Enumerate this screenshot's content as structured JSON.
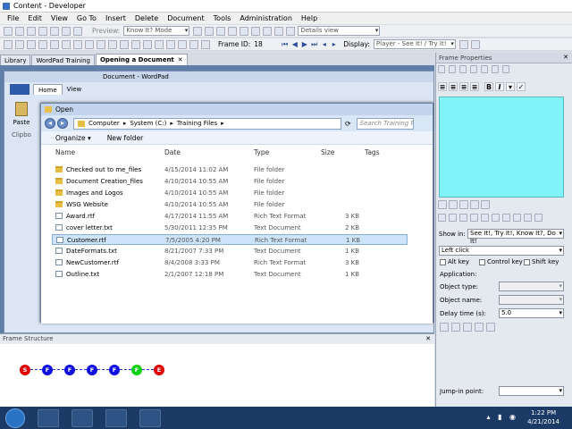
{
  "window": {
    "title": "Content - Developer"
  },
  "menu": [
    "File",
    "Edit",
    "View",
    "Go To",
    "Insert",
    "Delete",
    "Document",
    "Tools",
    "Administration",
    "Help"
  ],
  "toolbar": {
    "preview_label": "Preview:",
    "mode_value": "Know It? Mode",
    "view_value": "Details view",
    "frame_id_label": "Frame ID:",
    "frame_id": "18",
    "display_label": "Display:",
    "display_value": "Player - See It! / Try It!"
  },
  "tabs": [
    "Library",
    "WordPad Training",
    "Opening a Document"
  ],
  "wordpad": {
    "title": "Document - WordPad",
    "tab_home": "Home",
    "tab_view": "View",
    "paste": "Paste",
    "clipboard": "Clipbo"
  },
  "dialog": {
    "title": "Open",
    "path": [
      "Computer",
      "▸",
      "System (C:)",
      "▸",
      "Training Files",
      "▸"
    ],
    "search_placeholder": "Search Training Fi",
    "organize": "Organize ▾",
    "new_folder": "New folder",
    "columns": [
      "Name",
      "Date",
      "Type",
      "Size",
      "Tags"
    ],
    "files": [
      {
        "name": "Checked out to me_files",
        "date": "4/15/2014 11:02 AM",
        "type": "File folder",
        "size": "",
        "kind": "folder"
      },
      {
        "name": "Document Creation_files",
        "date": "4/10/2014 10:55 AM",
        "type": "File folder",
        "size": "",
        "kind": "folder"
      },
      {
        "name": "Images and Logos",
        "date": "4/10/2014 10:55 AM",
        "type": "File folder",
        "size": "",
        "kind": "folder"
      },
      {
        "name": "WSG Website",
        "date": "4/10/2014 10:55 AM",
        "type": "File folder",
        "size": "",
        "kind": "folder"
      },
      {
        "name": "Award.rtf",
        "date": "4/17/2014 11:55 AM",
        "type": "Rich Text Format",
        "size": "3 KB",
        "kind": "doc"
      },
      {
        "name": "cover letter.txt",
        "date": "5/30/2011 12:35 PM",
        "type": "Text Document",
        "size": "2 KB",
        "kind": "doc"
      },
      {
        "name": "Customer.rtf",
        "date": "7/5/2005 4:20 PM",
        "type": "Rich Text Format",
        "size": "1 KB",
        "kind": "doc",
        "selected": true
      },
      {
        "name": "DateFormats.txt",
        "date": "8/21/2007 7:33 PM",
        "type": "Text Document",
        "size": "1 KB",
        "kind": "doc"
      },
      {
        "name": "NewCustomer.rtf",
        "date": "8/4/2008 3:33 PM",
        "type": "Rich Text Format",
        "size": "3 KB",
        "kind": "doc"
      },
      {
        "name": "Outline.txt",
        "date": "2/1/2007 12:18 PM",
        "type": "Text Document",
        "size": "1 KB",
        "kind": "doc"
      }
    ]
  },
  "frame_properties": {
    "title": "Frame Properties",
    "fill_color": "#80f4f8",
    "show_in_label": "Show in:",
    "show_in_value": "See It!, Try It!, Know It?, Do It!",
    "action_value": "Left click",
    "alt_key": "Alt key",
    "control_key": "Control key",
    "shift_key": "Shift key",
    "application": "Application:",
    "object_type": "Object type:",
    "object_name": "Object name:",
    "delay_label": "Delay time (s):",
    "delay_value": "5.0",
    "jump_in": "Jump-in point:"
  },
  "frame_structure": {
    "title": "Frame Structure",
    "nodes": [
      "S",
      "F",
      "F",
      "F",
      "F",
      "F",
      "E"
    ],
    "node_colors": [
      "#e00000",
      "#1010e0",
      "#1010e0",
      "#1010e0",
      "#1010e0",
      "#10d010",
      "#e00000"
    ]
  },
  "taskbar": {
    "time": "1:22 PM",
    "date": "4/21/2014"
  }
}
